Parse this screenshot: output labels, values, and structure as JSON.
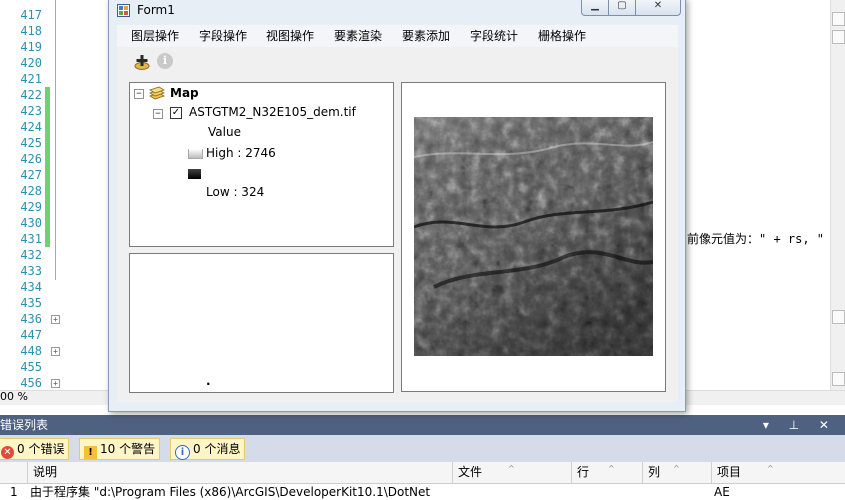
{
  "editor": {
    "line_numbers": [
      "417",
      "418",
      "419",
      "420",
      "421",
      "422",
      "423",
      "424",
      "425",
      "426",
      "427",
      "428",
      "429",
      "430",
      "431",
      "432",
      "433",
      "434",
      "435",
      "436",
      "447",
      "448",
      "455",
      "456"
    ],
    "changed_lines": [
      "422",
      "423",
      "424",
      "425",
      "426",
      "427",
      "428",
      "429",
      "430",
      "431"
    ],
    "folded_lines": [
      "436",
      "448",
      "456"
    ],
    "code_fragment": "前像元值为：\" + rs, \"",
    "zoom": "00 %"
  },
  "form1": {
    "title": "Form1",
    "menu": [
      "图层操作",
      "字段操作",
      "视图操作",
      "要素渲染",
      "要素添加",
      "字段统计",
      "栅格操作"
    ],
    "toolbar": {
      "add_data_icon": "add-data-icon",
      "identify_icon": "identify-icon",
      "identify_glyph": "i"
    },
    "toc": {
      "map_label": "Map",
      "layer_name": "ASTGTM2_N32E105_dem.tif",
      "layer_checked": true,
      "value_label": "Value",
      "high_label": "High : 2746",
      "low_label": "Low : 324"
    },
    "overview_marker": "."
  },
  "error_list": {
    "title": "错误列表",
    "title_controls": "▾ ⊥ ✕",
    "errors_label": "0 个错误",
    "warnings_label": "10 个警告",
    "messages_label": "0 个消息",
    "columns": [
      "说明",
      "文件",
      "行",
      "列",
      "项目"
    ],
    "first_row": {
      "index": "1",
      "description": "由于程序集 \"d:\\Program Files (x86)\\ArcGIS\\DeveloperKit10.1\\DotNet",
      "project": "AE"
    }
  },
  "colors": {
    "accent": "#4f6180",
    "gutter_change": "#6bd56b",
    "line_number": "#2b91af"
  }
}
